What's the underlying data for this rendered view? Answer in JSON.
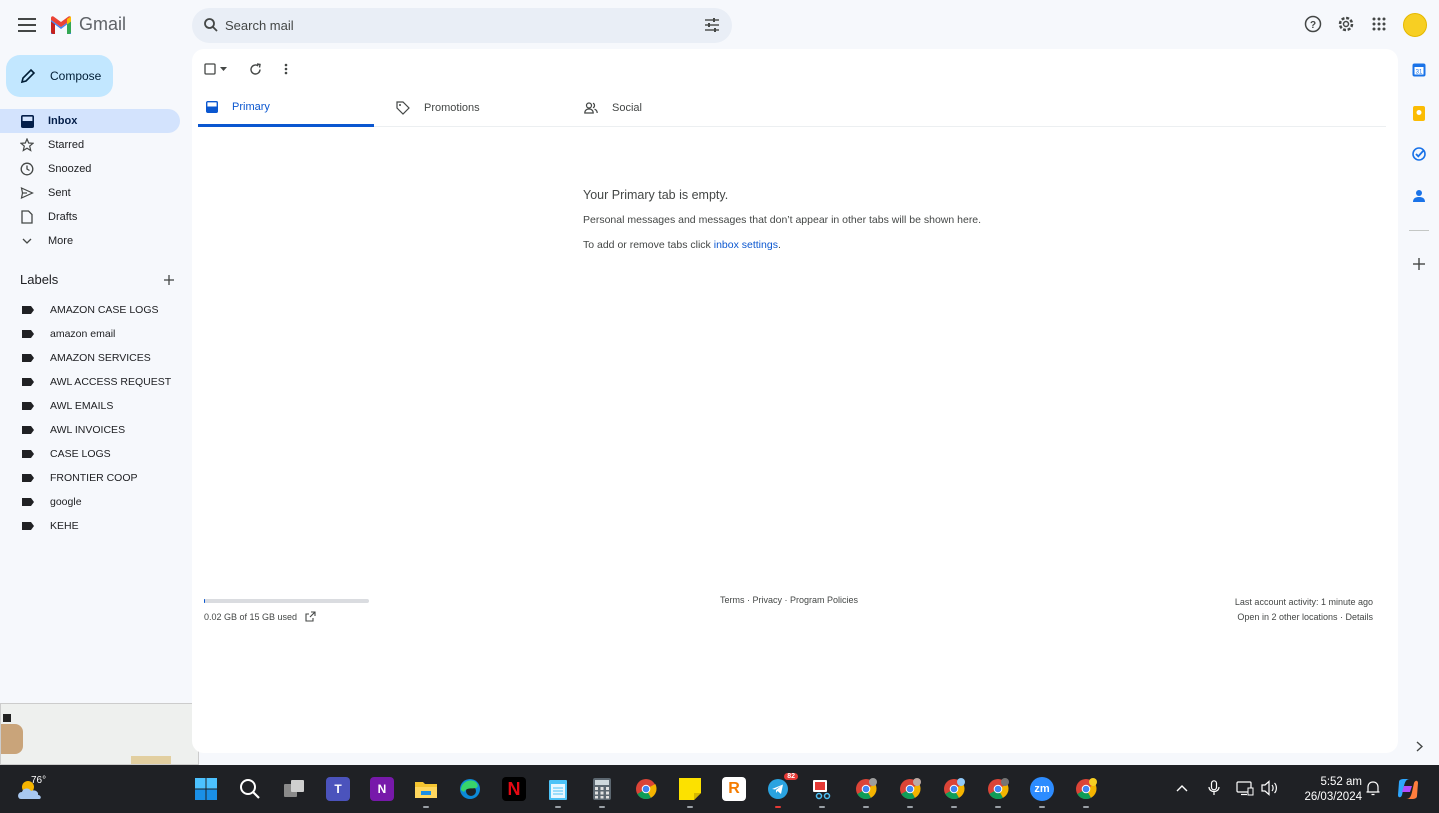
{
  "app": {
    "name": "Gmail"
  },
  "search": {
    "placeholder": "Search mail"
  },
  "compose": {
    "label": "Compose"
  },
  "nav": [
    {
      "label": "Inbox",
      "icon": "inbox-icon",
      "active": true
    },
    {
      "label": "Starred",
      "icon": "star-icon"
    },
    {
      "label": "Snoozed",
      "icon": "clock-icon"
    },
    {
      "label": "Sent",
      "icon": "send-icon"
    },
    {
      "label": "Drafts",
      "icon": "draft-icon"
    },
    {
      "label": "More",
      "icon": "chevron-down-icon"
    }
  ],
  "labels": {
    "heading": "Labels",
    "items": [
      "AMAZON CASE LOGS",
      "amazon email",
      "AMAZON SERVICES",
      "AWL ACCESS REQUEST",
      "AWL EMAILS",
      "AWL INVOICES",
      "CASE LOGS",
      "FRONTIER COOP",
      "google",
      "KEHE"
    ]
  },
  "tabs": [
    {
      "label": "Primary",
      "icon": "inbox-icon",
      "active": true
    },
    {
      "label": "Promotions",
      "icon": "tag-icon"
    },
    {
      "label": "Social",
      "icon": "people-icon"
    }
  ],
  "empty": {
    "title": "Your Primary tab is empty.",
    "body": "Personal messages and messages that don’t appear in other tabs will be shown here.",
    "settings_prefix": "To add or remove tabs click ",
    "settings_link": "inbox settings",
    "settings_suffix": "."
  },
  "storage": {
    "text": "0.02 GB of 15 GB used",
    "used_fraction": 0.0013
  },
  "footer": {
    "links": "Terms · Privacy · Program Policies",
    "activity": "Last account activity: 1 minute ago",
    "locations": "Open in 2 other locations · Details"
  },
  "taskbar": {
    "temperature": "76°",
    "time": "5:52 am",
    "date": "26/03/2024",
    "telegram_badge": "82"
  },
  "colors": {
    "accent": "#0b57d0",
    "compose_bg": "#c2e7ff",
    "active_nav": "#d3e3fd",
    "page_bg": "#f6f8fc",
    "taskbar_bg": "#1f2125"
  }
}
